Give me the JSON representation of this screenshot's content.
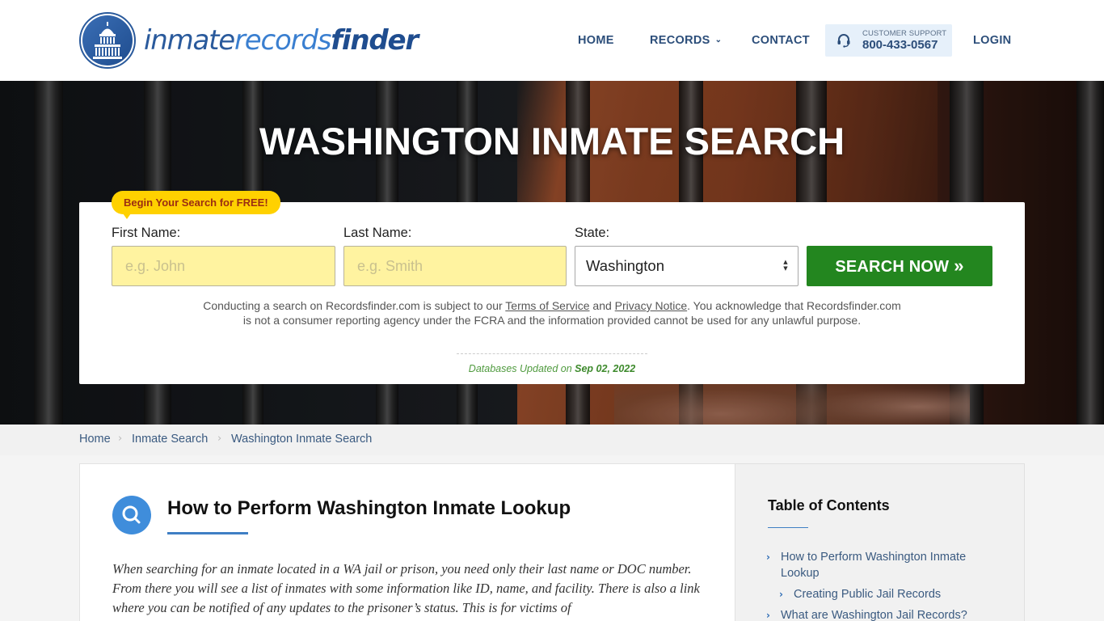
{
  "header": {
    "logo": {
      "part1": "inmate",
      "part2": "records",
      "part3": "finder",
      "icon": "capitol-dome-icon"
    },
    "nav": {
      "home": "HOME",
      "records": "RECORDS",
      "records_icon": "chevron-down-icon",
      "contact": "CONTACT",
      "login": "LOGIN"
    },
    "support": {
      "label": "CUSTOMER SUPPORT",
      "phone": "800-433-0567",
      "icon": "headset-icon"
    }
  },
  "hero": {
    "title": "WASHINGTON INMATE SEARCH"
  },
  "search_form": {
    "promo": "Begin Your Search for FREE!",
    "first_name": {
      "label": "First Name:",
      "value": "",
      "placeholder": "e.g. John"
    },
    "last_name": {
      "label": "Last Name:",
      "value": "",
      "placeholder": "e.g. Smith"
    },
    "state": {
      "label": "State:",
      "selected": "Washington"
    },
    "submit": "SEARCH NOW",
    "submit_icon": "double-chevron-right-icon",
    "disclaimer": {
      "before": "Conducting a search on Recordsfinder.com is subject to our ",
      "terms_link": "Terms of Service",
      "middle": " and ",
      "privacy_link": "Privacy Notice",
      "after": ". You acknowledge that Recordsfinder.com is not a consumer reporting agency under the FCRA and the information provided cannot be used for any unlawful purpose."
    },
    "updated_label": "Databases Updated on ",
    "updated_date": "Sep 02, 2022"
  },
  "breadcrumb": {
    "items": [
      "Home",
      "Inmate Search",
      "Washington Inmate Search"
    ],
    "separator": "›"
  },
  "main": {
    "section_icon": "search-icon",
    "section_title": "How to Perform Washington Inmate Lookup",
    "body": "When searching for an inmate located in a WA jail or prison, you need only their last name or DOC number. From there you will see a list of inmates with some information like ID, name, and facility. There is also a link where you can be notified of any updates to the prisoner’s status. This is for victims of"
  },
  "toc": {
    "title": "Table of Contents",
    "items": [
      {
        "label": "How to Perform Washington Inmate Lookup",
        "level": 1
      },
      {
        "label": "Creating Public Jail Records",
        "level": 2
      },
      {
        "label": "What are Washington Jail Records?",
        "level": 1
      }
    ],
    "chevron": "›"
  },
  "colors": {
    "brand_blue": "#2c4e7a",
    "search_green": "#23861f",
    "promo_yellow": "#ffd100",
    "input_yellow": "#fff3a0",
    "accent_blue": "#3f8ddb"
  }
}
